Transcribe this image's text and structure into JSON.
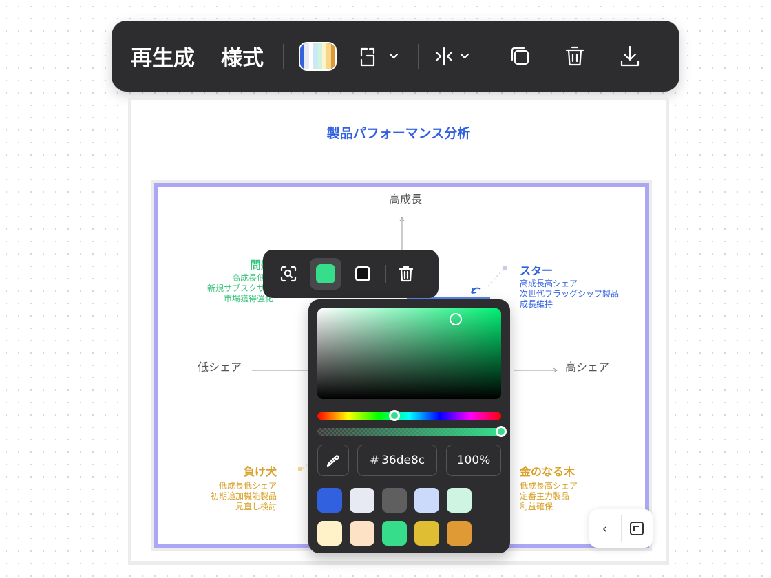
{
  "toolbar": {
    "regenerate_label": "再生成",
    "style_label": "様式",
    "palette_colors": [
      "#3261e0",
      "#e8eaf3",
      "#ffffff",
      "#cbe9f5",
      "#cdf5dd",
      "#fff3c9",
      "#f5d78c",
      "#e09a35"
    ],
    "icons": [
      "layout-icon",
      "chevron-down-icon",
      "mirror-icon",
      "chevron-down-icon",
      "copy-icon",
      "trash-icon",
      "download-icon"
    ]
  },
  "board": {
    "title": "製品パフォーマンス分析",
    "axis": {
      "top": "高成長",
      "left": "低シェア",
      "right": "高シェア"
    },
    "quadrants": {
      "problem": {
        "title": "問題",
        "lines": [
          "高成長低シ",
          "新規サブスクサー",
          "市場獲得強化"
        ]
      },
      "star": {
        "title": "スター",
        "lines": [
          "高成長高シェア",
          "次世代フラッグシップ製品",
          "成長維持"
        ]
      },
      "dog": {
        "title": "負け犬",
        "lines": [
          "低成長低シェア",
          "初期追加機能製品",
          "見直し検討"
        ]
      },
      "cow": {
        "title": "金のなる木",
        "lines": [
          "低成長高シェア",
          "定番主力製品",
          "利益確保"
        ]
      }
    }
  },
  "mini_toolbar": {
    "fill_color": "#36de8c",
    "stroke_color": "#111111"
  },
  "color_picker": {
    "hex_prefix": "#",
    "hex_value": "36de8c",
    "opacity": "100%",
    "hue_position": 0.42,
    "alpha_position": 1.0,
    "swatches": [
      "#3261e0",
      "#e8eaf3",
      "#5f5f5f",
      "#cbd9fb",
      "#cdf5e1",
      "#fff1c8",
      "#fde2c6",
      "#36de8c",
      "#dfbe33",
      "#e09a35"
    ]
  },
  "corner": {
    "collapse_symbol": "‹"
  }
}
